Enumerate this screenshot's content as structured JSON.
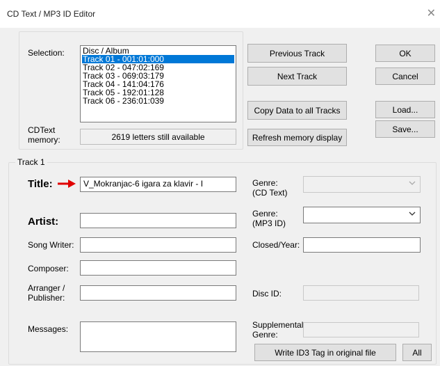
{
  "window": {
    "title": "CD Text / MP3 ID Editor",
    "close_glyph": "✕"
  },
  "selection": {
    "label": "Selection:",
    "items": [
      "Disc / Album",
      "Track 01  -  001:01:000",
      "Track 02  -  047:02:169",
      "Track 03  -  069:03:179",
      "Track 04  -  141:04:176",
      "Track 05  -  192:01:128",
      "Track 06  -  236:01:039"
    ],
    "selected_index": 1
  },
  "cdtext_memory": {
    "label_line1": "CDText",
    "label_line2": "memory:",
    "value": "2619 letters still available"
  },
  "buttons": {
    "previous_track": "Previous Track",
    "next_track": "Next Track",
    "copy_data": "Copy Data to all Tracks",
    "refresh_memory": "Refresh memory display",
    "ok": "OK",
    "cancel": "Cancel",
    "load": "Load...",
    "save": "Save...",
    "write_id3": "Write ID3 Tag in original file",
    "all": "All"
  },
  "track": {
    "group_label": "Track 1",
    "title_label": "Title:",
    "title_value": "V_Mokranjac-6 igara za klavir - I",
    "artist_label": "Artist:",
    "artist_value": "",
    "song_writer_label": "Song Writer:",
    "song_writer_value": "",
    "composer_label": "Composer:",
    "composer_value": "",
    "arranger_label_line1": "Arranger /",
    "arranger_label_line2": "Publisher:",
    "arranger_value": "",
    "messages_label": "Messages:",
    "messages_value": "",
    "genre_cdtext_label_line1": "Genre:",
    "genre_cdtext_label_line2": "(CD Text)",
    "genre_cdtext_value": "",
    "genre_mp3_label_line1": "Genre:",
    "genre_mp3_label_line2": "(MP3 ID)",
    "genre_mp3_value": "",
    "closed_year_label": "Closed/Year:",
    "closed_year_value": "",
    "disc_id_label": "Disc ID:",
    "disc_id_value": "",
    "supplemental_genre_label_line1": "Supplemental",
    "supplemental_genre_label_line2": "Genre:",
    "supplemental_genre_value": ""
  },
  "icons": {
    "arrow": "red-arrow-icon",
    "dropdown": "chevron-down-icon",
    "arrow_color": "#e00000"
  }
}
